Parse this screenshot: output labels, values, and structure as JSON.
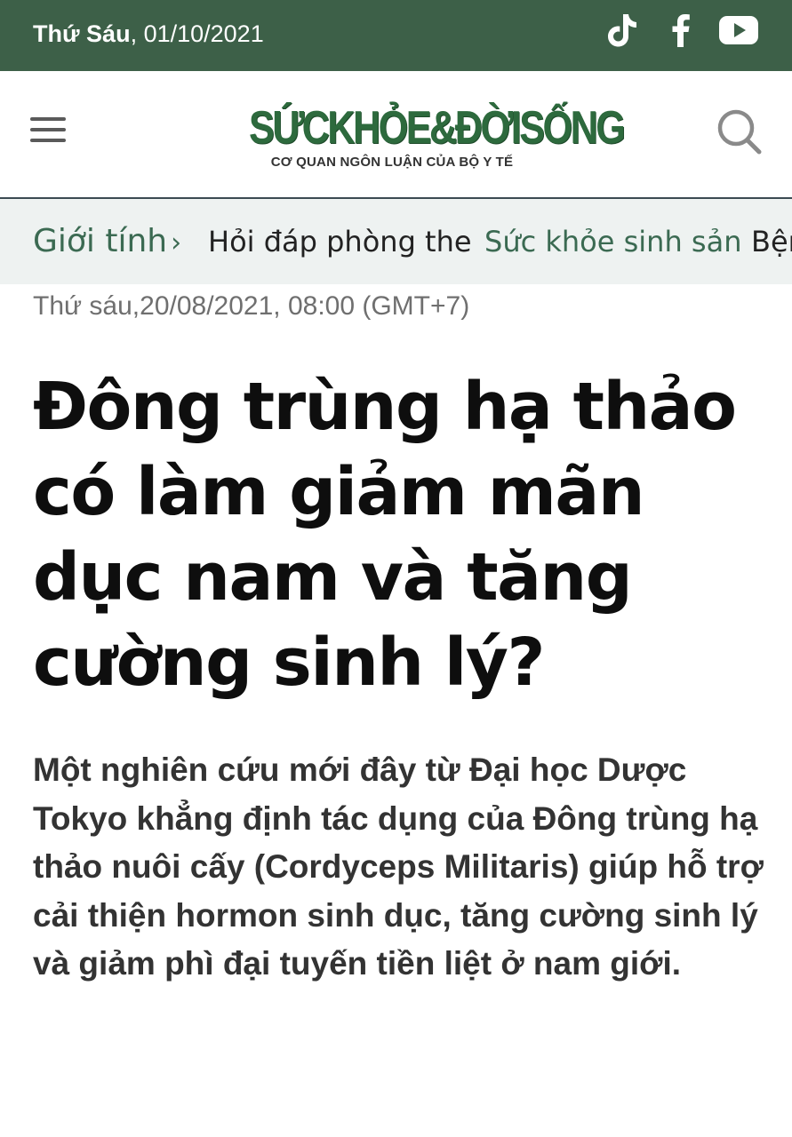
{
  "topbar": {
    "weekday": "Thứ Sáu",
    "date": "01/10/2021",
    "background_color": "#3d6048",
    "social": [
      {
        "icon": "tiktok-icon"
      },
      {
        "icon": "facebook-icon"
      },
      {
        "icon": "youtube-icon"
      }
    ]
  },
  "header": {
    "logo_main": "SỨCKHỎE&ĐỜISỐNG",
    "logo_sub": "CƠ QUAN NGÔN LUẬN CỦA BỘ Y TẾ",
    "menu_icon": "hamburger-menu-icon",
    "search_icon": "search-icon",
    "brand_color": "#2d6a3d"
  },
  "category_nav": {
    "main": "Giới tính",
    "items": [
      "Hỏi đáp phòng the",
      "Sức khỏe sinh sản",
      "Bện"
    ],
    "accent_color": "#3b6a52"
  },
  "article": {
    "published": "Thứ sáu,20/08/2021, 08:00 (GMT+7)",
    "title": "Đông trùng hạ thảo có làm giảm mãn dục nam và tăng cường sinh lý?",
    "sapo": "Một nghiên cứu mới đây từ Đại học Dược Tokyo khẳng định tác dụng của Đông trùng hạ thảo nuôi cấy (Cordyceps Militaris) giúp hỗ trợ cải thiện hormon sinh dục, tăng cường sinh lý và giảm phì đại tuyến tiền liệt ở nam giới."
  }
}
